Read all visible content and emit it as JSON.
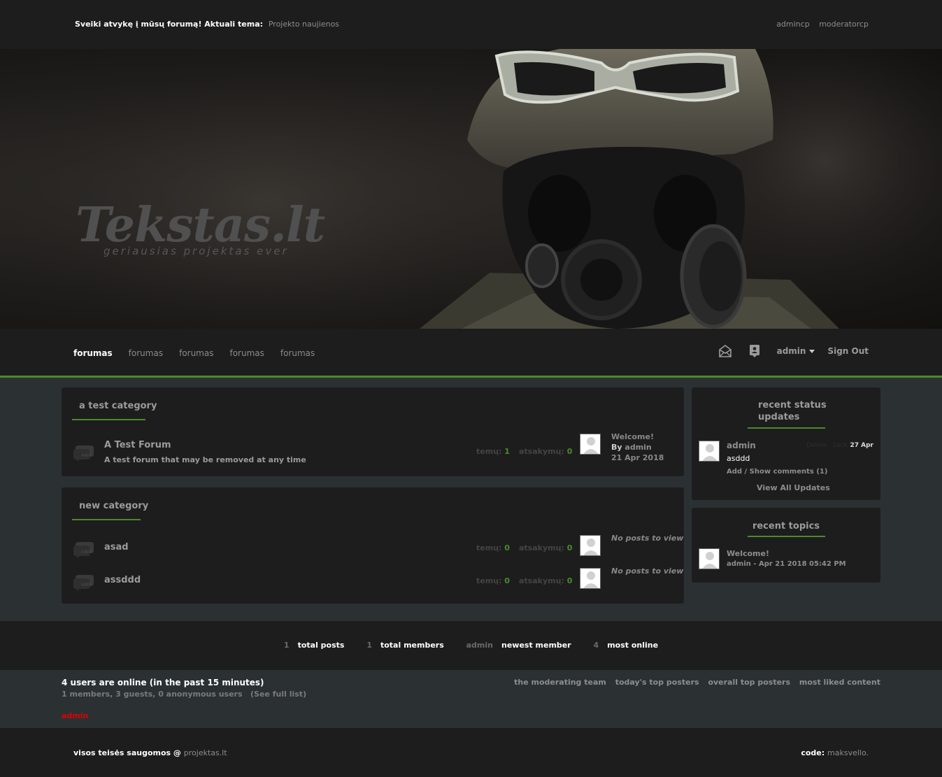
{
  "topbar": {
    "welcome": "Sveiki atvykę į mūsų forumą! Aktuali tema:",
    "topic_link": "Projekto naujienos",
    "links": [
      "admincp",
      "moderatorcp"
    ]
  },
  "banner": {
    "logo": "Tekstas.lt",
    "tagline": "geriausias projektas ever"
  },
  "nav": {
    "items": [
      "forumas",
      "forumas",
      "forumas",
      "forumas",
      "forumas"
    ],
    "user": "admin",
    "signout": "Sign Out"
  },
  "categories": [
    {
      "title": "a test category",
      "forums": [
        {
          "name": "A Test Forum",
          "desc": "A test forum that may be removed at any time",
          "topics_label": "temų:",
          "topics": "1",
          "replies_label": "atsakymų:",
          "replies": "0",
          "last_title": "Welcome!",
          "last_by_label": "By",
          "last_by": "admin",
          "last_date": "21 Apr 2018"
        }
      ]
    },
    {
      "title": "new category",
      "forums": [
        {
          "name": "asad",
          "topics_label": "temų:",
          "topics": "0",
          "replies_label": "atsakymų:",
          "replies": "0",
          "last_empty": "No posts to view"
        },
        {
          "name": "assddd",
          "topics_label": "temų:",
          "topics": "0",
          "replies_label": "atsakymų:",
          "replies": "0",
          "last_empty": "No posts to view"
        }
      ]
    }
  ],
  "status": {
    "title_line1": "recent status",
    "title_line2": "updates",
    "user": "admin",
    "actions": "Delete · Lock",
    "date": "27 Apr",
    "text": "asddd",
    "comments": "Add / Show comments (1)",
    "view_all": "View All Updates"
  },
  "recent_topics": {
    "title": "recent topics",
    "topic": "Welcome!",
    "meta": "admin - Apr 21 2018 05:42 PM"
  },
  "stats": {
    "posts_n": "1",
    "posts_l": "total posts",
    "members_n": "1",
    "members_l": "total members",
    "newest_n": "admin",
    "newest_l": "newest member",
    "online_n": "4",
    "online_l": "most online"
  },
  "online": {
    "line1": "4 users are online (in the past 15 minutes)",
    "line2": "1 members, 3 guests, 0 anonymous users",
    "see_list": "(See full list)",
    "admin": "admin",
    "links": [
      "the moderating team",
      "today's top posters",
      "overall top posters",
      "most liked content"
    ]
  },
  "footer": {
    "copy": "visos teisės saugomos @",
    "copy_link": "projektas.lt",
    "code_label": "code:",
    "code_link": "maksvello."
  },
  "colors": {
    "accent": "#4a8a2c",
    "panel": "#1d1d1d",
    "body": "#2b3133",
    "admin_red": "#e10000"
  }
}
